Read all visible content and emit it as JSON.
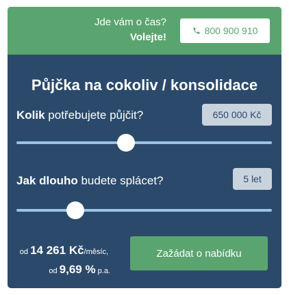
{
  "call_bar": {
    "question": "Jde vám o čas?",
    "cta": "Volejte!",
    "phone_number": "800 900 910",
    "phone_icon": "phone-icon"
  },
  "title": "Půjčka na cokoliv / konsolidace",
  "amount": {
    "label_bold": "Kolik",
    "label_rest": " potřebujete půjčit?",
    "value": "650 000 Kč",
    "slider_fraction": 0.43
  },
  "duration": {
    "label_bold": "Jak dlouho",
    "label_rest": " budete splácet?",
    "value": "5 let",
    "slider_fraction": 0.23
  },
  "summary": {
    "od1": "od",
    "monthly_amount": "14 261 Kč",
    "monthly_unit": "/měsíc,",
    "od2": "od",
    "rate": "9,69 %",
    "rate_unit": "p.a."
  },
  "submit_label": "Zažádat o nabídku",
  "colors": {
    "green": "#5aa56f",
    "navy": "#2b4a6b",
    "track": "#9ec2e4",
    "badge": "#c9d3dd"
  }
}
